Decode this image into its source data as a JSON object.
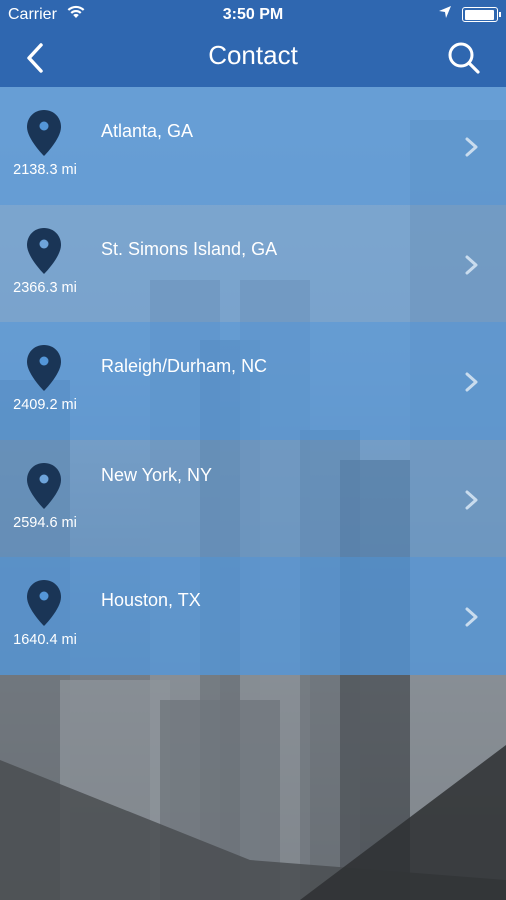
{
  "status_bar": {
    "carrier": "Carrier",
    "time": "3:50 PM"
  },
  "header": {
    "title": "Contact",
    "back_icon": "chevron-left-icon",
    "search_icon": "search-icon"
  },
  "colors": {
    "header_bg": "#2f67b0",
    "row_bg": "#5496d8",
    "pin": "#1a3556",
    "chevron": "#c9dcee"
  },
  "locations": [
    {
      "city": "Atlanta, GA",
      "distance": "2138.3 mi"
    },
    {
      "city": "St. Simons Island, GA",
      "distance": "2366.3 mi"
    },
    {
      "city": "Raleigh/Durham, NC",
      "distance": "2409.2 mi"
    },
    {
      "city": "New York, NY",
      "distance": "2594.6 mi"
    },
    {
      "city": "Houston, TX",
      "distance": "1640.4 mi"
    }
  ]
}
